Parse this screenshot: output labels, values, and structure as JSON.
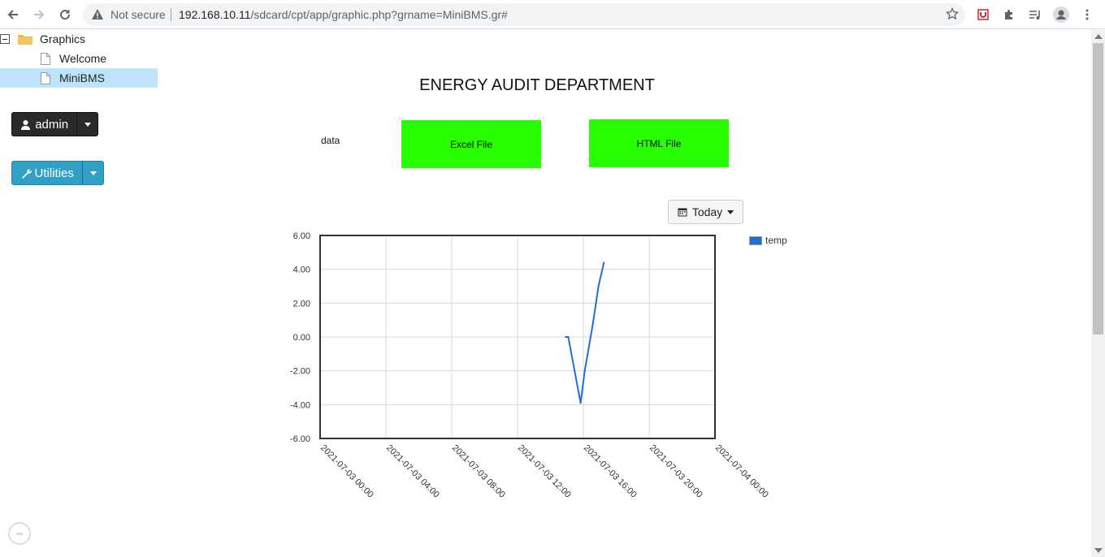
{
  "browser": {
    "security_label": "Not secure",
    "url_host": "192.168.10.11",
    "url_path": "/sdcard/cpt/app/graphic.php?grname=MiniBMS.gr#"
  },
  "sidebar": {
    "root_label": "Graphics",
    "items": [
      {
        "label": "Welcome",
        "selected": false
      },
      {
        "label": "MiniBMS",
        "selected": true
      }
    ],
    "user_button_label": "admin",
    "utilities_button_label": "Utilities"
  },
  "main": {
    "title": "ENERGY AUDIT DEPARTMENT",
    "data_label": "data",
    "excel_button_label": "Excel File",
    "html_button_label": "HTML File",
    "range_button_label": "Today"
  },
  "colors": {
    "accent_green": "#27ff00",
    "series": "#1f6fd1",
    "selected_row": "#bde4fb"
  },
  "chart_data": {
    "type": "line",
    "title": "",
    "xlabel": "",
    "ylabel": "",
    "x_ticks": [
      "2021-07-03 00:00",
      "2021-07-03 04:00",
      "2021-07-03 08:00",
      "2021-07-03 12:00",
      "2021-07-03 16:00",
      "2021-07-03 20:00",
      "2021-07-04 00:00"
    ],
    "y_ticks": [
      "6.00",
      "4.00",
      "2.00",
      "0.00",
      "-2.00",
      "-4.00",
      "-6.00"
    ],
    "ylim": [
      -6,
      6
    ],
    "xlim": [
      "2021-07-03 00:00",
      "2021-07-04 00:00"
    ],
    "grid": true,
    "legend_position": "right",
    "series": [
      {
        "name": "temp",
        "color": "#1f6fd1",
        "points": [
          {
            "x": "2021-07-03 14:55",
            "y": 0.0
          },
          {
            "x": "2021-07-03 15:05",
            "y": 0.0
          },
          {
            "x": "2021-07-03 15:50",
            "y": -3.9
          },
          {
            "x": "2021-07-03 16:05",
            "y": -2.0
          },
          {
            "x": "2021-07-03 16:35",
            "y": 0.8
          },
          {
            "x": "2021-07-03 16:55",
            "y": 3.0
          },
          {
            "x": "2021-07-03 17:15",
            "y": 4.4
          }
        ]
      }
    ]
  }
}
